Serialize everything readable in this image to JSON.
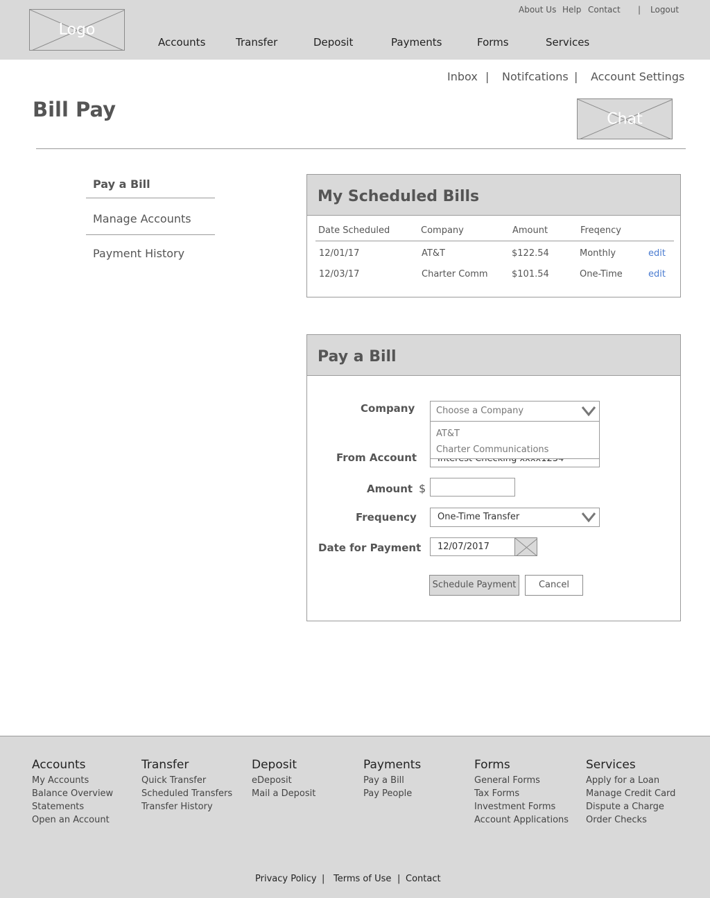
{
  "header": {
    "logo": "Logo",
    "utility": {
      "about": "About Us",
      "help": "Help",
      "contact": "Contact",
      "separator": "|",
      "logout": "Logout"
    },
    "nav": [
      "Accounts",
      "Transfer",
      "Deposit",
      "Payments",
      "Forms",
      "Services"
    ]
  },
  "subnav": {
    "inbox": "Inbox",
    "notifications": "Notifcations",
    "account_settings": "Account Settings",
    "separator": "|"
  },
  "page": {
    "title": "Bill Pay",
    "chat": "Chat"
  },
  "sidebar": {
    "items": [
      {
        "label": "Pay a Bill",
        "active": true
      },
      {
        "label": "Manage Accounts",
        "active": false
      },
      {
        "label": "Payment History",
        "active": false
      }
    ]
  },
  "scheduled_bills": {
    "title": "My Scheduled Bills",
    "columns": [
      "Date Scheduled",
      "Company",
      "Amount",
      "Freqency"
    ],
    "rows": [
      {
        "date": "12/01/17",
        "company": "AT&T",
        "amount": "$122.54",
        "frequency": "Monthly",
        "action": "edit"
      },
      {
        "date": "12/03/17",
        "company": "Charter Comm",
        "amount": "$101.54",
        "frequency": "One-Time",
        "action": "edit"
      }
    ]
  },
  "pay_bill": {
    "title": "Pay a Bill",
    "company_label": "Company",
    "company_placeholder": "Choose a Company",
    "company_options": [
      "AT&T",
      "Charter Communications"
    ],
    "from_account_label": "From Account",
    "from_account_value": "Interest Checking xxxx1234",
    "amount_label": "Amount",
    "amount_prefix": "$",
    "amount_value": "",
    "frequency_label": "Frequency",
    "frequency_value": "One-Time Transfer",
    "date_label": "Date for Payment",
    "date_value": "12/07/2017",
    "schedule_button": "Schedule Payment",
    "cancel_button": "Cancel"
  },
  "footer": {
    "columns": [
      {
        "heading": "Accounts",
        "links": [
          "My Accounts",
          "Balance Overview",
          "Statements",
          "Open an Account"
        ]
      },
      {
        "heading": "Transfer",
        "links": [
          "Quick Transfer",
          "Scheduled Transfers",
          "Transfer History"
        ]
      },
      {
        "heading": "Deposit",
        "links": [
          "eDeposit",
          "Mail a Deposit"
        ]
      },
      {
        "heading": "Payments",
        "links": [
          "Pay a Bill",
          "Pay People"
        ]
      },
      {
        "heading": "Forms",
        "links": [
          "General Forms",
          "Tax Forms",
          "Investment Forms",
          "Account Applications"
        ]
      },
      {
        "heading": "Services",
        "links": [
          "Apply for a Loan",
          "Manage Credit Card",
          "Dispute a Charge",
          "Order Checks"
        ]
      }
    ],
    "legal": {
      "privacy": "Privacy Policy",
      "terms": "Terms of Use",
      "contact": "Contact",
      "separator": "|"
    }
  },
  "colors": {
    "chrome_gray": "#d9d9d9",
    "text_gray": "#555555",
    "link_blue": "#4a7bd0"
  }
}
